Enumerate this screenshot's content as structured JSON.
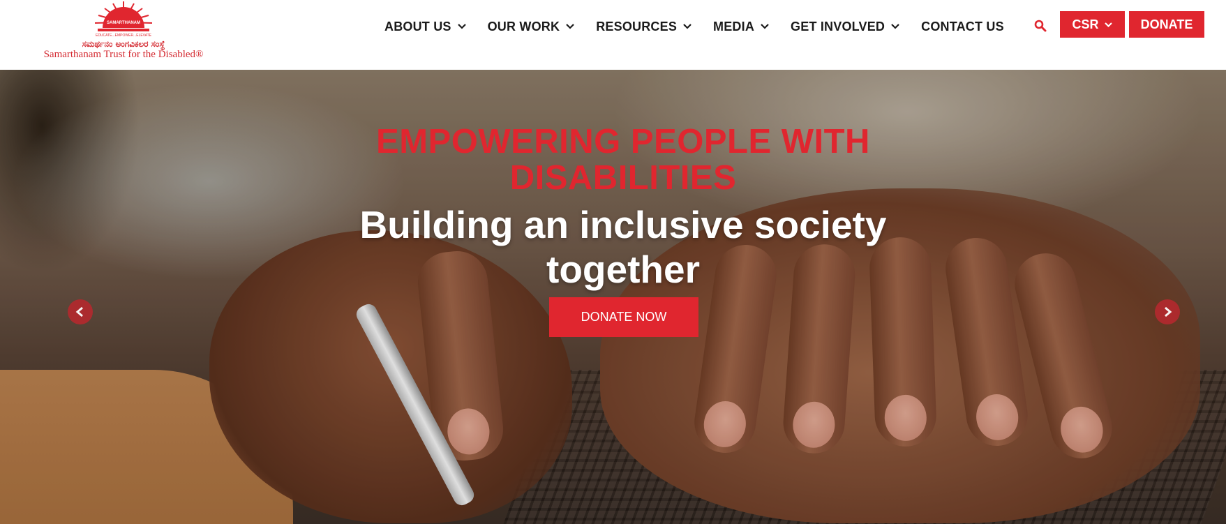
{
  "brand": {
    "logo_arc_text": "SAMARTHANAM",
    "logo_tagline": "EDUCATE...EMPOWER...ELEVATE",
    "kannada_name": "ಸಮರ್ಥನಂ ಅಂಗವಿಕಲರ ಸಂಸ್ಥೆ",
    "english_name": "Samarthanam Trust for the Disabled®"
  },
  "nav": {
    "items": [
      {
        "label": "ABOUT US",
        "has_dropdown": true
      },
      {
        "label": "OUR WORK",
        "has_dropdown": true
      },
      {
        "label": "RESOURCES",
        "has_dropdown": true
      },
      {
        "label": "MEDIA",
        "has_dropdown": true
      },
      {
        "label": "GET INVOLVED",
        "has_dropdown": true
      },
      {
        "label": "CONTACT US",
        "has_dropdown": false
      }
    ],
    "search_icon": "search-icon",
    "csr_label": "CSR",
    "donate_label": "DONATE"
  },
  "hero": {
    "kicker": "EMPOWERING PEOPLE WITH DISABILITIES",
    "title": "Building an inclusive society together",
    "cta_label": "DONATE NOW",
    "prev_icon": "chevron-left-icon",
    "next_icon": "chevron-right-icon"
  },
  "colors": {
    "brand_red": "#e0262f",
    "arrow_bg": "#b02a2e",
    "nav_text": "#1a1a1a"
  }
}
